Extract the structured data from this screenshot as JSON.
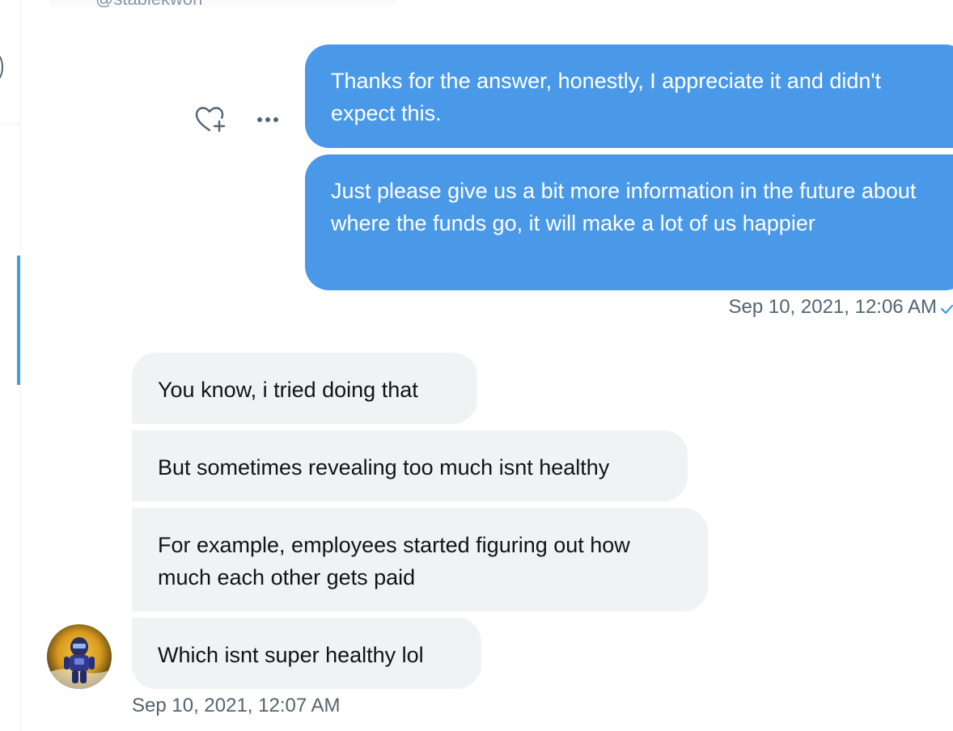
{
  "header": {
    "handle": "@stablekwon"
  },
  "sent_messages": [
    {
      "text": "Thanks for the answer, honestly, I appreciate it and didn't expect this."
    },
    {
      "text": "Just please give us a bit more information in the future about where the funds go, it will make a lot of us happier"
    }
  ],
  "sent_timestamp": "Sep 10, 2021, 12:06 AM",
  "received_messages": [
    {
      "text": "You know, i tried doing that"
    },
    {
      "text": "But sometimes revealing too much isnt healthy"
    },
    {
      "text": "For example, employees started figuring out how much each other gets paid"
    },
    {
      "text": "Which isnt super healthy lol"
    }
  ],
  "received_timestamp": "Sep 10, 2021, 12:07 AM",
  "icons": {
    "react": "heart-plus-icon",
    "more": "more-icon",
    "seen": "check-icon"
  },
  "colors": {
    "sent_bubble": "#4a99e9",
    "received_bubble": "#eff3f4",
    "timestamp_text": "#536471",
    "accent": "#1d9bf0"
  }
}
